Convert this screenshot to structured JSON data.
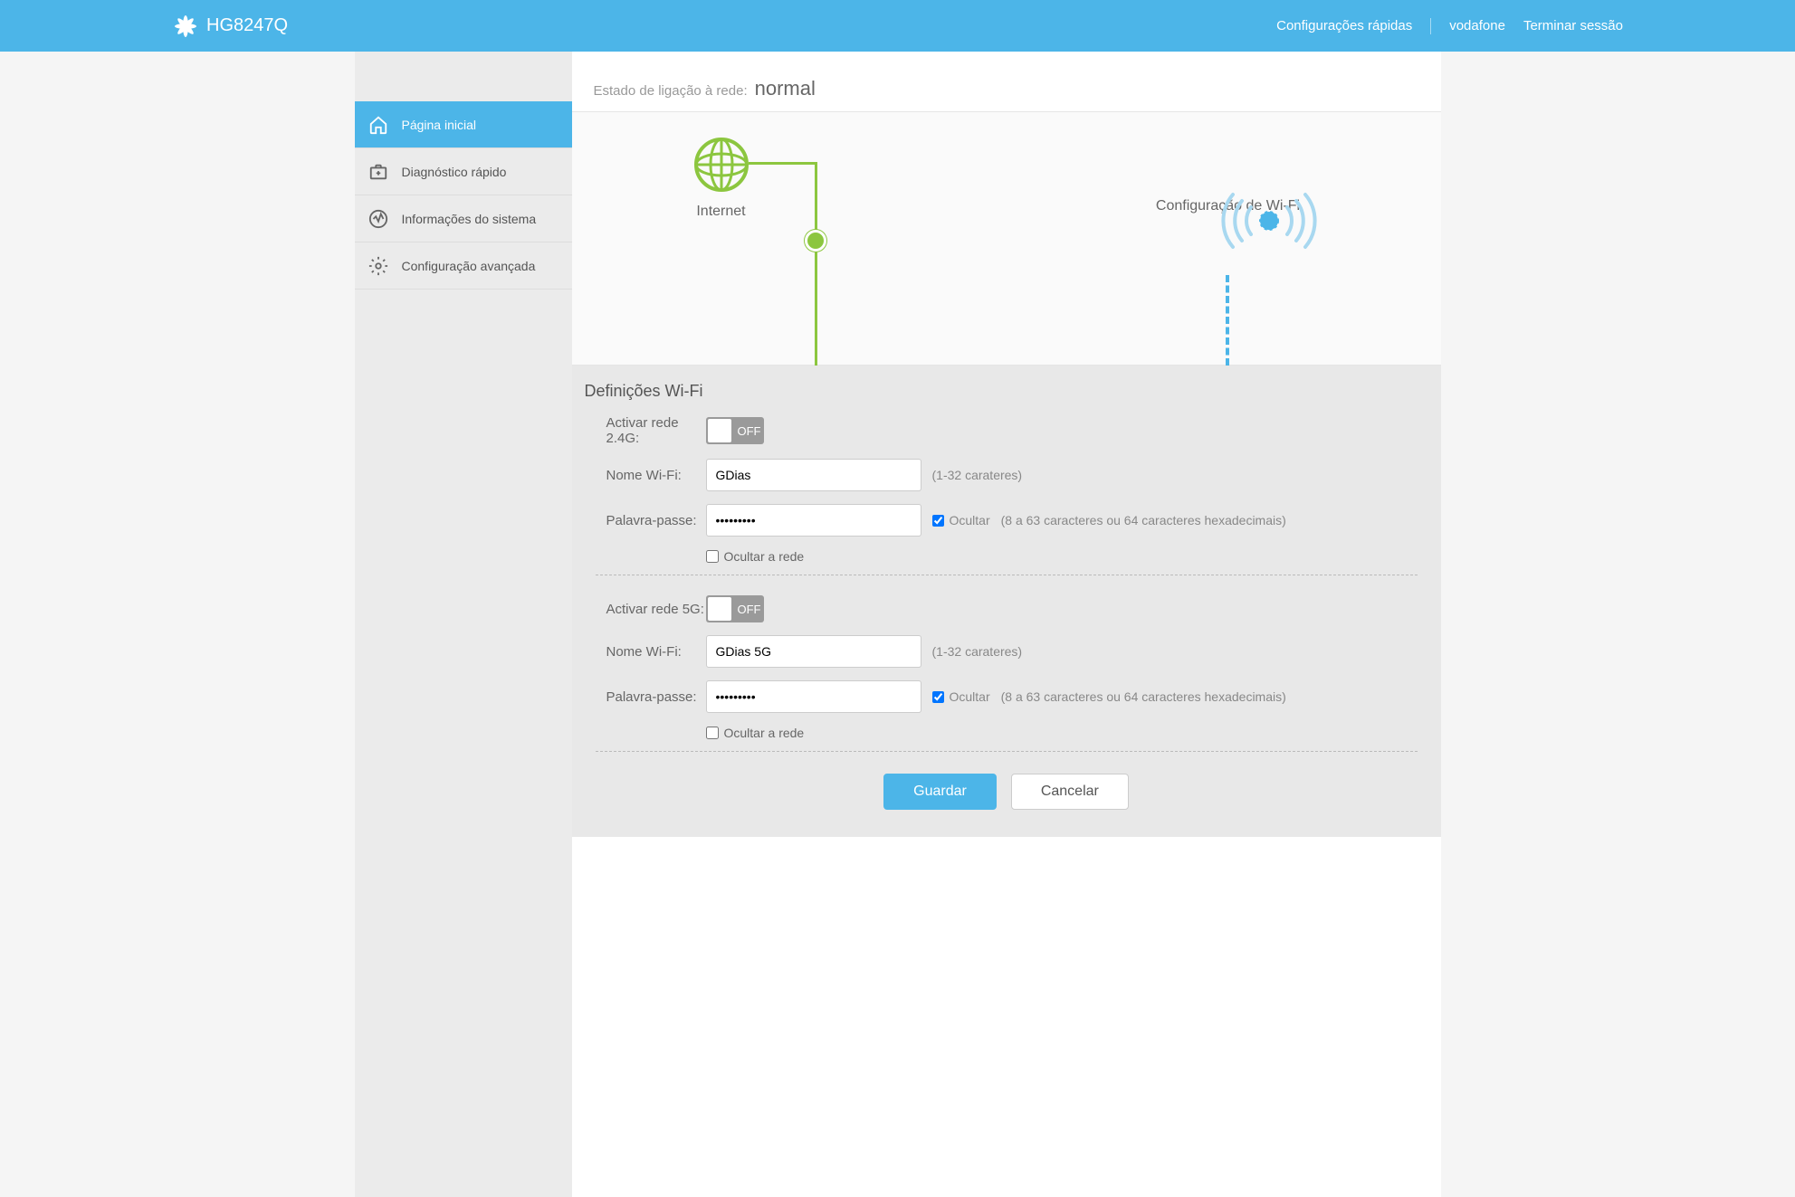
{
  "header": {
    "model": "HG8247Q",
    "links": {
      "quick_config": "Configurações rápidas",
      "user": "vodafone",
      "logout": "Terminar sessão"
    }
  },
  "sidebar": {
    "items": [
      {
        "label": "Página inicial"
      },
      {
        "label": "Diagnóstico rápido"
      },
      {
        "label": "Informações do sistema"
      },
      {
        "label": "Configuração avançada"
      }
    ]
  },
  "status": {
    "label": "Estado de ligação à rede:",
    "value": "normal"
  },
  "diagram": {
    "internet": "Internet",
    "wifi": "Configuração de Wi-Fi"
  },
  "wifi_settings": {
    "title": "Definições Wi-Fi",
    "toggle_off": "OFF",
    "band_2g": {
      "enable_label": "Activar rede 2.4G:",
      "name_label": "Nome Wi-Fi:",
      "name_value": "GDias",
      "name_hint": "(1-32 carateres)",
      "password_label": "Palavra-passe:",
      "password_value": "•••••••••",
      "hide_pwd": "Ocultar",
      "pwd_hint": "(8 a 63 caracteres ou 64 caracteres hexadecimais)",
      "hide_network": "Ocultar a rede"
    },
    "band_5g": {
      "enable_label": "Activar rede 5G:",
      "name_label": "Nome Wi-Fi:",
      "name_value": "GDias 5G",
      "name_hint": "(1-32 carateres)",
      "password_label": "Palavra-passe:",
      "password_value": "•••••••••",
      "hide_pwd": "Ocultar",
      "pwd_hint": "(8 a 63 caracteres ou 64 caracteres hexadecimais)",
      "hide_network": "Ocultar a rede"
    },
    "save": "Guardar",
    "cancel": "Cancelar"
  }
}
